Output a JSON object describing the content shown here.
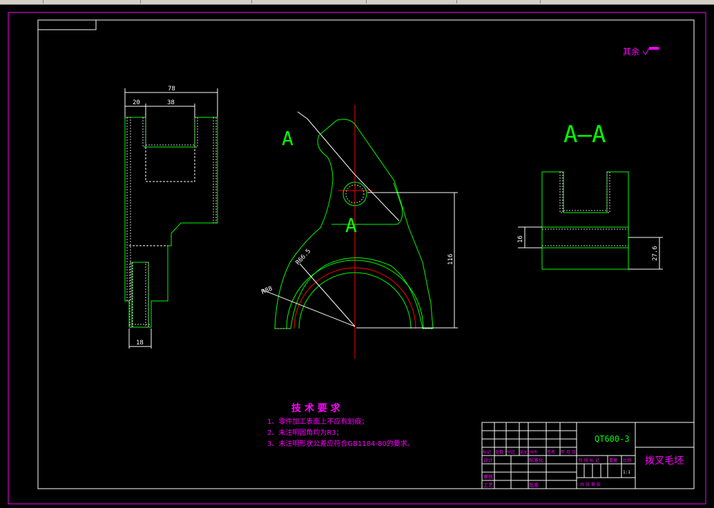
{
  "colors": {
    "background": "#000000",
    "frame": "#ffffff",
    "outer_border": "#ff00ff",
    "part_outline": "#00ff00",
    "center_line": "#ff0000",
    "dimension": "#ffffff",
    "tech_text": "#ff00ff"
  },
  "roughness_note": "其余",
  "dimensions": {
    "side_width_total": "78",
    "side_width_left": "20",
    "side_width_slot": "38",
    "side_width_bottom": "18",
    "radius_inner": "R66.5",
    "radius_outer": "R88",
    "height_center": "116",
    "section_slot": "16",
    "section_height": "27.6"
  },
  "section_label": "A—A",
  "section_marker_1": "A",
  "section_marker_2": "A",
  "technical_requirements": {
    "title": "技 术 要 求",
    "items": [
      "1、零件加工表面上不应有划痕；",
      "2、未注明圆角均为R3；",
      "3、未注明形状公差应符合GB1184-80的要求。"
    ]
  },
  "title_block": {
    "drawing_number": "QT600-3",
    "part_name": "拨叉毛坯",
    "revision_headers": [
      "标记",
      "处数",
      "分区",
      "更改文件号",
      "签名",
      "年 月 日"
    ],
    "role_labels": [
      "设计",
      "审核",
      "工艺"
    ],
    "role_labels_mid": [
      "标准化",
      "",
      "批准"
    ],
    "stage_headers": [
      "阶 段 标 记",
      "重量",
      "比例"
    ],
    "scale": "1:1",
    "sheet_info": "共  张  第  张"
  }
}
